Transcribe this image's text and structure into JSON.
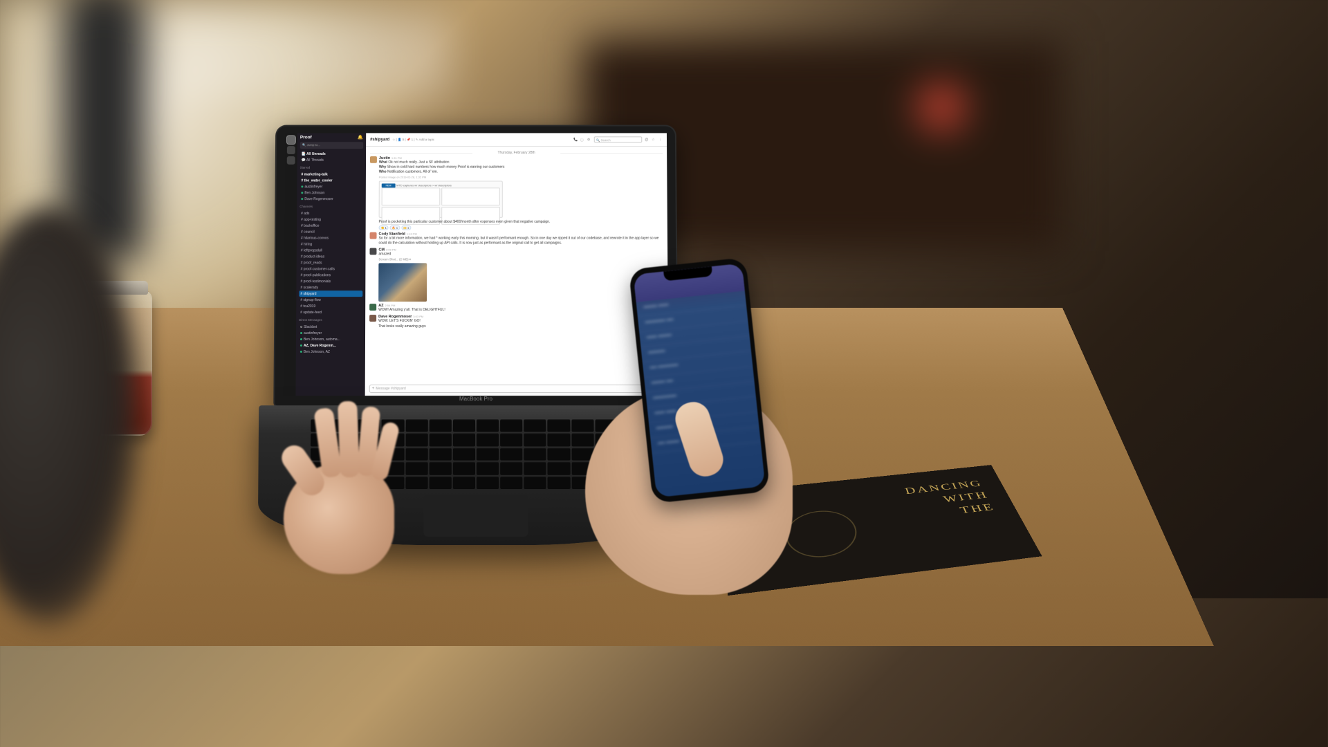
{
  "laptop_label": "MacBook Pro",
  "slack": {
    "workspace": "Proof",
    "jump_placeholder": "Jump to...",
    "search_placeholder": "Search",
    "sections": {
      "unreads_label": "All Unreads",
      "threads_label": "All Threads",
      "starred_title": "Starred",
      "channels_title": "Channels",
      "dms_title": "Direct Messages"
    },
    "starred": [
      "marketing-talk",
      "the_water_cooler",
      "austinfreyer",
      "Ben Johnson",
      "Dave Rogenmoser"
    ],
    "channels": [
      "ads",
      "app-testing",
      "backoffice",
      "council",
      "hilarious-convos",
      "hiring",
      "leftpropsdull",
      "product-ideas",
      "proof_reads",
      "proof-customer-calls",
      "proof-publications",
      "proof-testimonials",
      "scalerady",
      "shipyard",
      "signup-flow",
      "tcu2019",
      "update-feed"
    ],
    "active_channel": "shipyard",
    "dms": [
      "Slackbot",
      "austinfreyer",
      "Ben Johnson, automa...",
      "AZ, Dave Rogenm...",
      "Ben Johnson, AZ"
    ],
    "channel_header": {
      "name": "#shipyard",
      "members": "9",
      "pins": "1",
      "topic": "Add a topic"
    },
    "date_divider": "Thursday, February 28th",
    "messages": [
      {
        "author": "Justin",
        "time": "1:31 PM",
        "avatar": "#c89860",
        "lines": [
          {
            "label": "What",
            "text": "Ok not much really. Just a SF attribution"
          },
          {
            "label": "Why",
            "text": "Show in cold hard numbers how much money Proof is earning our customers"
          },
          {
            "label": "Who",
            "text": "Notification customers. All of 'em."
          }
        ],
        "posted_note": "Posted image on 2019-02-28, 1:32 PM",
        "attachment_caption": "MTD captures w/ descriptors > w/ descriptors",
        "attachment_tab": "NEW"
      },
      {
        "author": "",
        "time": "",
        "avatar": "",
        "standalone_text": "Proof is pocketing this particular customer about $400/month after expenses even given that negative campaign.",
        "reactions": [
          "👏 1",
          "🔥 1",
          "🙌 1"
        ]
      },
      {
        "author": "Cody Stanfield",
        "time": "1:43 PM",
        "avatar": "#d4846a",
        "text": "So for a bit more information, we had * working early this morning, but it wasn't performant enough. So in one day we ripped it out of our codebase, and rewrote it in the app layer so we could do the calculation without holding up API calls. It is now just as performant as the original call to get all campaigns."
      },
      {
        "author": "CM",
        "time": "2:09 PM",
        "avatar": "#48484a",
        "text": "amazed",
        "file_note": "Screen Shot... (2 MB) ▾",
        "has_image": true
      },
      {
        "author": "AZ",
        "time": "2:54 PM",
        "avatar": "#3a6a4a",
        "text": "WOW! Amazing y'all. That is DELIGHTFUL!"
      },
      {
        "author": "Dave Rogenmoser",
        "time": "3:03 PM",
        "avatar": "#7a5a4a",
        "text": "WOW. LET'S FUCKIN' GO!",
        "followup": "That looks really amazing guys"
      }
    ],
    "compose_placeholder": "Message #shipyard"
  },
  "book": {
    "line1": "DANCING",
    "line2": "WITH",
    "line3": "THE"
  }
}
